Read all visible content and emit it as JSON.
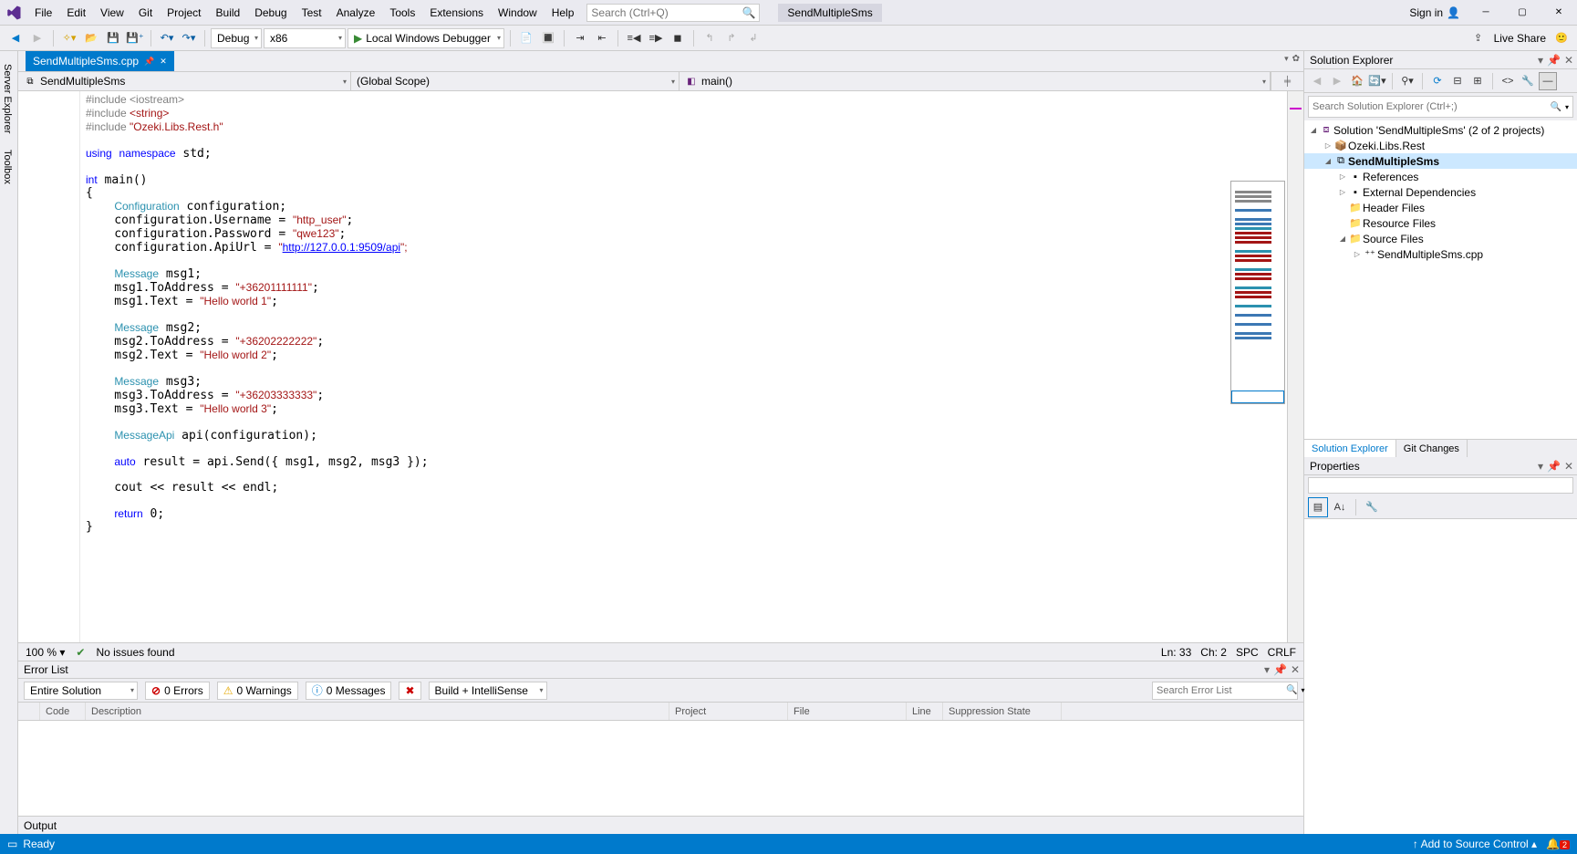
{
  "menu": [
    "File",
    "Edit",
    "View",
    "Git",
    "Project",
    "Build",
    "Debug",
    "Test",
    "Analyze",
    "Tools",
    "Extensions",
    "Window",
    "Help"
  ],
  "search_placeholder": "Search (Ctrl+Q)",
  "solution_label": "SendMultipleSms",
  "signin": "Sign in",
  "toolbar": {
    "config": "Debug",
    "platform": "x86",
    "start": "Local Windows Debugger",
    "liveshare": "Live Share"
  },
  "doc_tab": "SendMultipleSms.cpp",
  "nav": {
    "class": "SendMultipleSms",
    "scope": "(Global Scope)",
    "func": "main()"
  },
  "code_lines": [
    {
      "t": "pp",
      "x": "#include <iostream>"
    },
    {
      "t": "pp2",
      "a": "#include ",
      "b": "<string>"
    },
    {
      "t": "pp2",
      "a": "#include ",
      "b": "\"Ozeki.Libs.Rest.h\""
    },
    {
      "t": "blank"
    },
    {
      "t": "ns",
      "a": "using",
      "b": "namespace",
      "c": "std;"
    },
    {
      "t": "blank"
    },
    {
      "t": "fn",
      "a": "int",
      "b": "main()"
    },
    {
      "t": "sym",
      "x": "{"
    },
    {
      "t": "decl",
      "a": "Configuration",
      "b": "configuration;"
    },
    {
      "t": "assign",
      "a": "configuration.Username = ",
      "b": "\"http_user\"",
      "c": ";"
    },
    {
      "t": "assign",
      "a": "configuration.Password = ",
      "b": "\"qwe123\"",
      "c": ";"
    },
    {
      "t": "urlassign",
      "a": "configuration.ApiUrl = ",
      "q": "\"",
      "u": "http://127.0.0.1:9509/api",
      "c": "\";"
    },
    {
      "t": "blank"
    },
    {
      "t": "decl",
      "a": "Message",
      "b": "msg1;"
    },
    {
      "t": "assign",
      "a": "msg1.ToAddress = ",
      "b": "\"+36201111111\"",
      "c": ";"
    },
    {
      "t": "assign",
      "a": "msg1.Text = ",
      "b": "\"Hello world 1\"",
      "c": ";"
    },
    {
      "t": "blank"
    },
    {
      "t": "decl",
      "a": "Message",
      "b": "msg2;"
    },
    {
      "t": "assign",
      "a": "msg2.ToAddress = ",
      "b": "\"+36202222222\"",
      "c": ";"
    },
    {
      "t": "assign",
      "a": "msg2.Text = ",
      "b": "\"Hello world 2\"",
      "c": ";"
    },
    {
      "t": "blank"
    },
    {
      "t": "decl",
      "a": "Message",
      "b": "msg3;"
    },
    {
      "t": "assign",
      "a": "msg3.ToAddress = ",
      "b": "\"+36203333333\"",
      "c": ";"
    },
    {
      "t": "assign",
      "a": "msg3.Text = ",
      "b": "\"Hello world 3\"",
      "c": ";"
    },
    {
      "t": "blank"
    },
    {
      "t": "decl",
      "a": "MessageApi",
      "b": "api(configuration);"
    },
    {
      "t": "blank"
    },
    {
      "t": "auto",
      "a": "auto",
      "b": " result = api.Send({ msg1, msg2, msg3 });"
    },
    {
      "t": "blank"
    },
    {
      "t": "plain",
      "x": "cout << result << endl;"
    },
    {
      "t": "blank"
    },
    {
      "t": "ret",
      "a": "return",
      "b": "0",
      "c": ";"
    },
    {
      "t": "sym",
      "x": "}"
    }
  ],
  "status": {
    "zoom": "100 %",
    "issues": "No issues found",
    "ln": "Ln: 33",
    "ch": "Ch: 2",
    "spc": "SPC",
    "crlf": "CRLF"
  },
  "error_list": {
    "title": "Error List",
    "scope": "Entire Solution",
    "errors": "0 Errors",
    "warnings": "0 Warnings",
    "messages": "0 Messages",
    "build": "Build + IntelliSense",
    "search": "Search Error List",
    "cols": [
      "",
      "Code",
      "Description",
      "Project",
      "File",
      "Line",
      "Suppression State"
    ]
  },
  "output_title": "Output",
  "solution_explorer": {
    "title": "Solution Explorer",
    "search": "Search Solution Explorer (Ctrl+;)",
    "root": "Solution 'SendMultipleSms' (2 of 2 projects)",
    "items": [
      {
        "indent": 1,
        "arrow": "▷",
        "icon": "📦",
        "label": "Ozeki.Libs.Rest"
      },
      {
        "indent": 1,
        "arrow": "◢",
        "icon": "⧉",
        "label": "SendMultipleSms",
        "sel": true,
        "bold": true
      },
      {
        "indent": 2,
        "arrow": "▷",
        "icon": "▪",
        "label": "References"
      },
      {
        "indent": 2,
        "arrow": "▷",
        "icon": "▪",
        "label": "External Dependencies"
      },
      {
        "indent": 2,
        "arrow": "",
        "icon": "📁",
        "label": "Header Files"
      },
      {
        "indent": 2,
        "arrow": "",
        "icon": "📁",
        "label": "Resource Files"
      },
      {
        "indent": 2,
        "arrow": "◢",
        "icon": "📁",
        "label": "Source Files"
      },
      {
        "indent": 3,
        "arrow": "▷",
        "icon": "⁺⁺",
        "label": "SendMultipleSms.cpp"
      }
    ],
    "tabs": [
      "Solution Explorer",
      "Git Changes"
    ]
  },
  "properties_title": "Properties",
  "statusbar": {
    "ready": "Ready",
    "source_control": "Add to Source Control",
    "notif_count": "2"
  },
  "left_tabs": [
    "Server Explorer",
    "Toolbox"
  ]
}
